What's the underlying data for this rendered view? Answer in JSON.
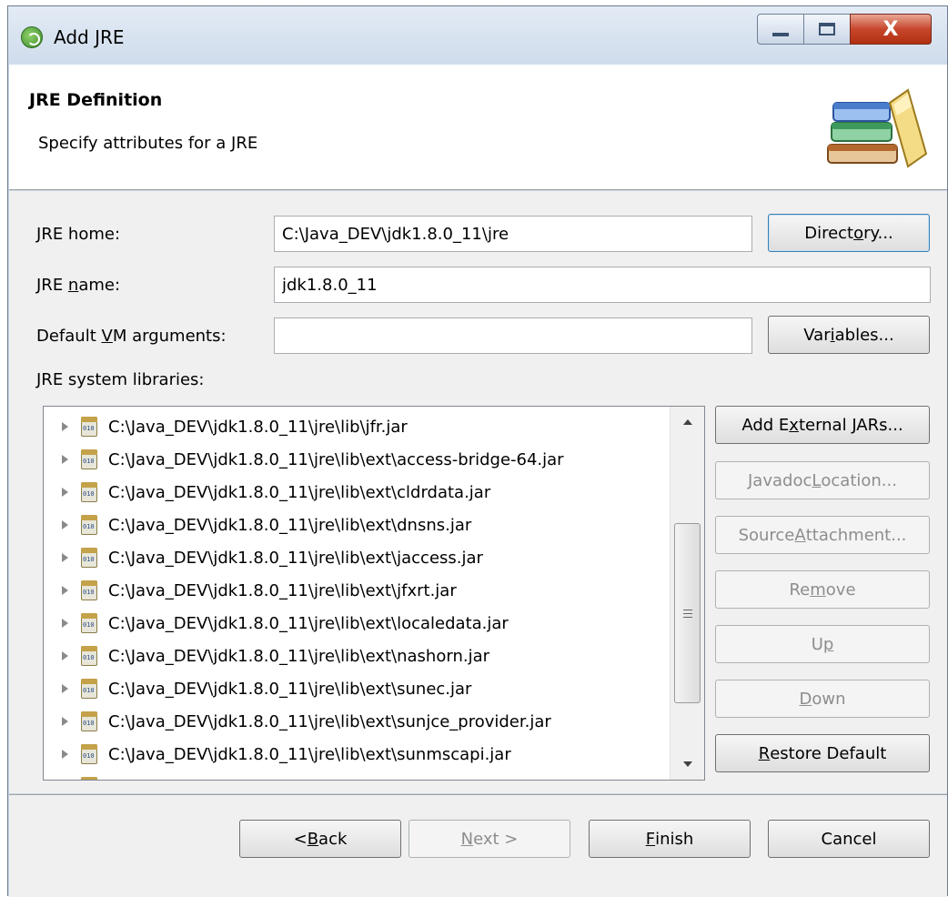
{
  "window": {
    "title": "Add JRE",
    "minimize_icon": "minimize-icon",
    "maximize_icon": "maximize-icon",
    "close_label": "X"
  },
  "header": {
    "title": "JRE Definition",
    "description": "Specify attributes for a JRE",
    "icon": "books-icon"
  },
  "form": {
    "jre_home": {
      "label_pre": "",
      "mnemonic": "J",
      "label_post": "RE home:",
      "value": "C:\\Java_DEV\\jdk1.8.0_11\\jre"
    },
    "jre_name": {
      "label_pre": "JRE ",
      "mnemonic": "n",
      "label_post": "ame:",
      "value": "jdk1.8.0_11"
    },
    "vm_args": {
      "label_pre": "Default ",
      "mnemonic": "V",
      "label_post": "M arguments:",
      "value": ""
    },
    "libraries_label": "JRE system libraries:"
  },
  "buttons": {
    "directory": {
      "pre": "Direct",
      "mnemonic": "o",
      "post": "ry..."
    },
    "variables": {
      "pre": "Var",
      "mnemonic": "i",
      "post": "ables..."
    },
    "add_external_jars": {
      "pre": "Add E",
      "mnemonic": "x",
      "post": "ternal JARs..."
    },
    "javadoc_location": {
      "pre": "Javadoc ",
      "mnemonic": "L",
      "post": "ocation..."
    },
    "source_attachment": {
      "pre": "Source ",
      "mnemonic": "A",
      "post": "ttachment..."
    },
    "remove": {
      "pre": "Re",
      "mnemonic": "m",
      "post": "ove"
    },
    "up": {
      "pre": "U",
      "mnemonic": "p",
      "post": ""
    },
    "down": {
      "pre": "",
      "mnemonic": "D",
      "post": "own"
    },
    "restore_default": {
      "pre": "",
      "mnemonic": "R",
      "post": "estore Default"
    },
    "back": {
      "pre": "< ",
      "mnemonic": "B",
      "post": "ack"
    },
    "next": {
      "pre": "",
      "mnemonic": "N",
      "post": "ext >"
    },
    "finish": {
      "pre": "",
      "mnemonic": "F",
      "post": "inish"
    },
    "cancel": {
      "pre": "Cancel",
      "mnemonic": "",
      "post": ""
    }
  },
  "libraries": [
    "C:\\Java_DEV\\jdk1.8.0_11\\jre\\lib\\jfr.jar",
    "C:\\Java_DEV\\jdk1.8.0_11\\jre\\lib\\ext\\access-bridge-64.jar",
    "C:\\Java_DEV\\jdk1.8.0_11\\jre\\lib\\ext\\cldrdata.jar",
    "C:\\Java_DEV\\jdk1.8.0_11\\jre\\lib\\ext\\dnsns.jar",
    "C:\\Java_DEV\\jdk1.8.0_11\\jre\\lib\\ext\\jaccess.jar",
    "C:\\Java_DEV\\jdk1.8.0_11\\jre\\lib\\ext\\jfxrt.jar",
    "C:\\Java_DEV\\jdk1.8.0_11\\jre\\lib\\ext\\localedata.jar",
    "C:\\Java_DEV\\jdk1.8.0_11\\jre\\lib\\ext\\nashorn.jar",
    "C:\\Java_DEV\\jdk1.8.0_11\\jre\\lib\\ext\\sunec.jar",
    "C:\\Java_DEV\\jdk1.8.0_11\\jre\\lib\\ext\\sunjce_provider.jar",
    "C:\\Java_DEV\\jdk1.8.0_11\\jre\\lib\\ext\\sunmscapi.jar"
  ]
}
